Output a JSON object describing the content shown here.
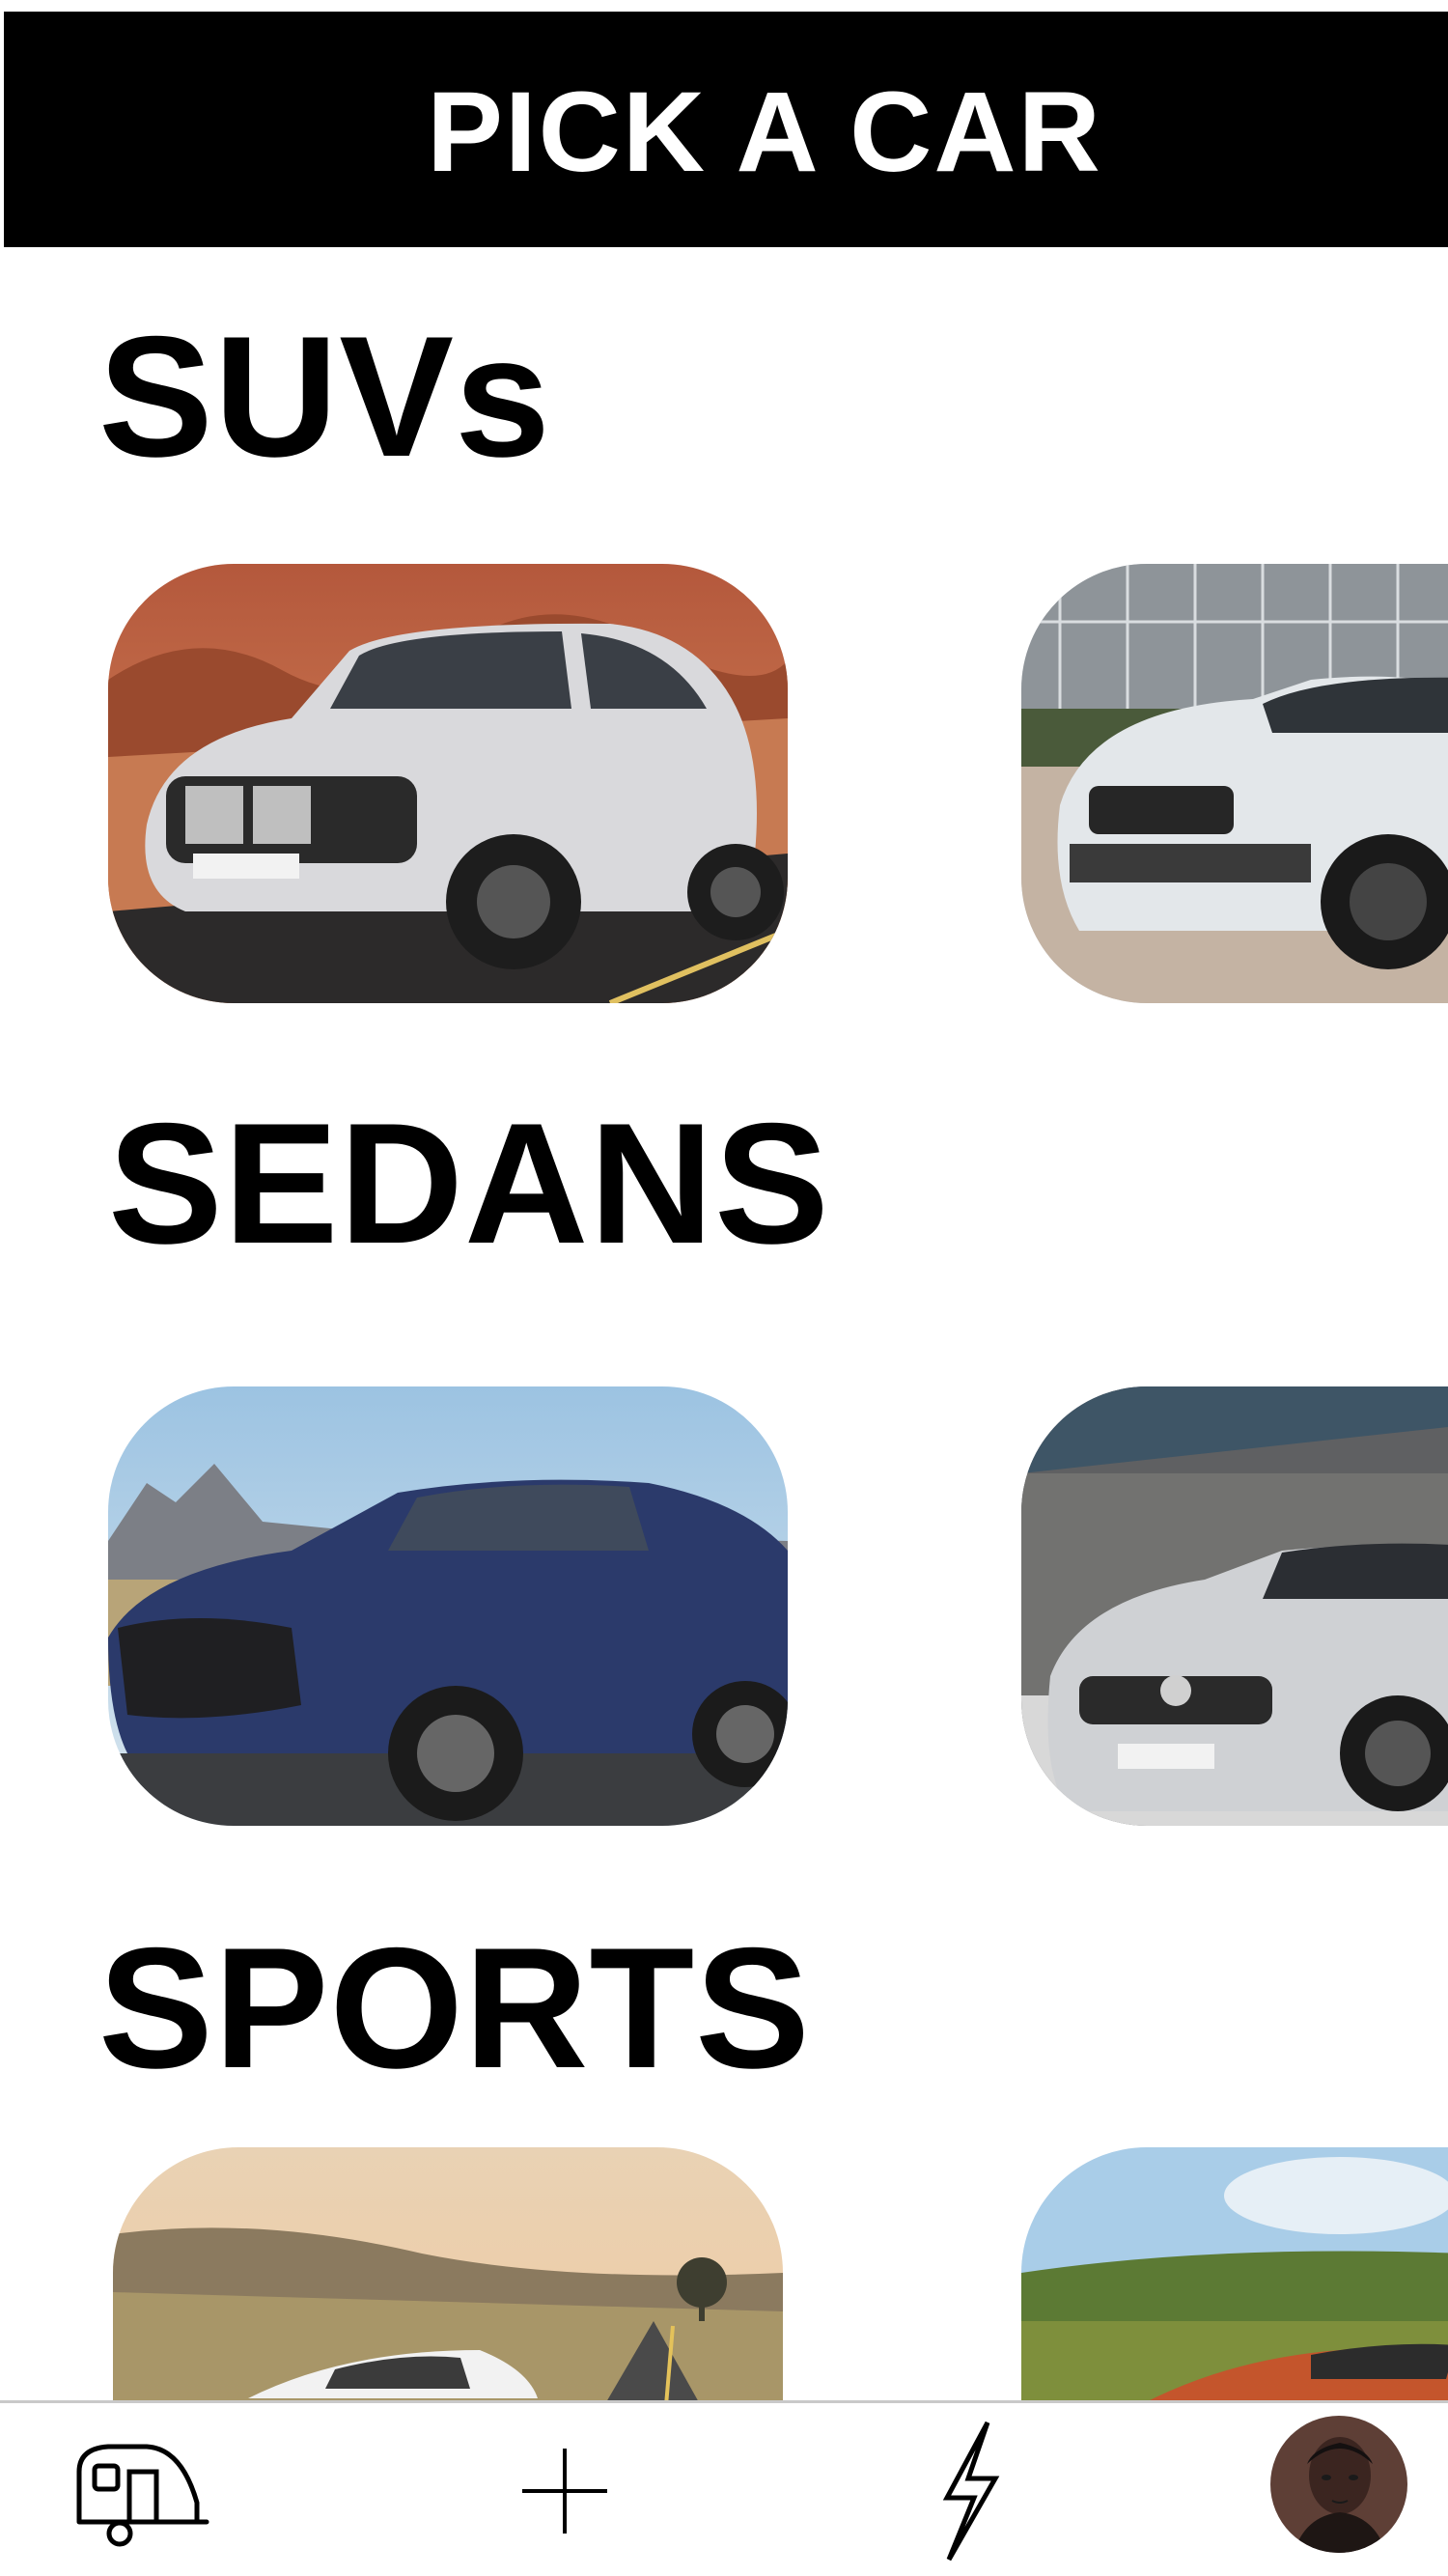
{
  "header": {
    "title": "PICK A CAR"
  },
  "sections": [
    {
      "heading": "SUVs",
      "cards": [
        {
          "image": "silver BMW X5 SUV on desert road"
        },
        {
          "image": "white Range Rover SUV parked by glass building"
        }
      ]
    },
    {
      "heading": "SEDANS",
      "cards": [
        {
          "image": "blue Lexus sedan on road with mountains"
        },
        {
          "image": "silver Mercedes sedan by concrete wall"
        }
      ]
    },
    {
      "heading": "SPORTS",
      "cards": [
        {
          "image": "white sports car on country road at sunset"
        },
        {
          "image": "orange Aston Martin sports car in countryside"
        }
      ]
    }
  ],
  "bottom_nav": {
    "items": [
      {
        "icon": "camper-trailer-icon"
      },
      {
        "icon": "plus-icon"
      },
      {
        "icon": "lightning-icon"
      },
      {
        "icon": "profile-avatar"
      }
    ]
  },
  "colors": {
    "header_bg": "#000000",
    "header_text": "#ffffff",
    "page_bg": "#ffffff",
    "heading_text": "#000000"
  }
}
